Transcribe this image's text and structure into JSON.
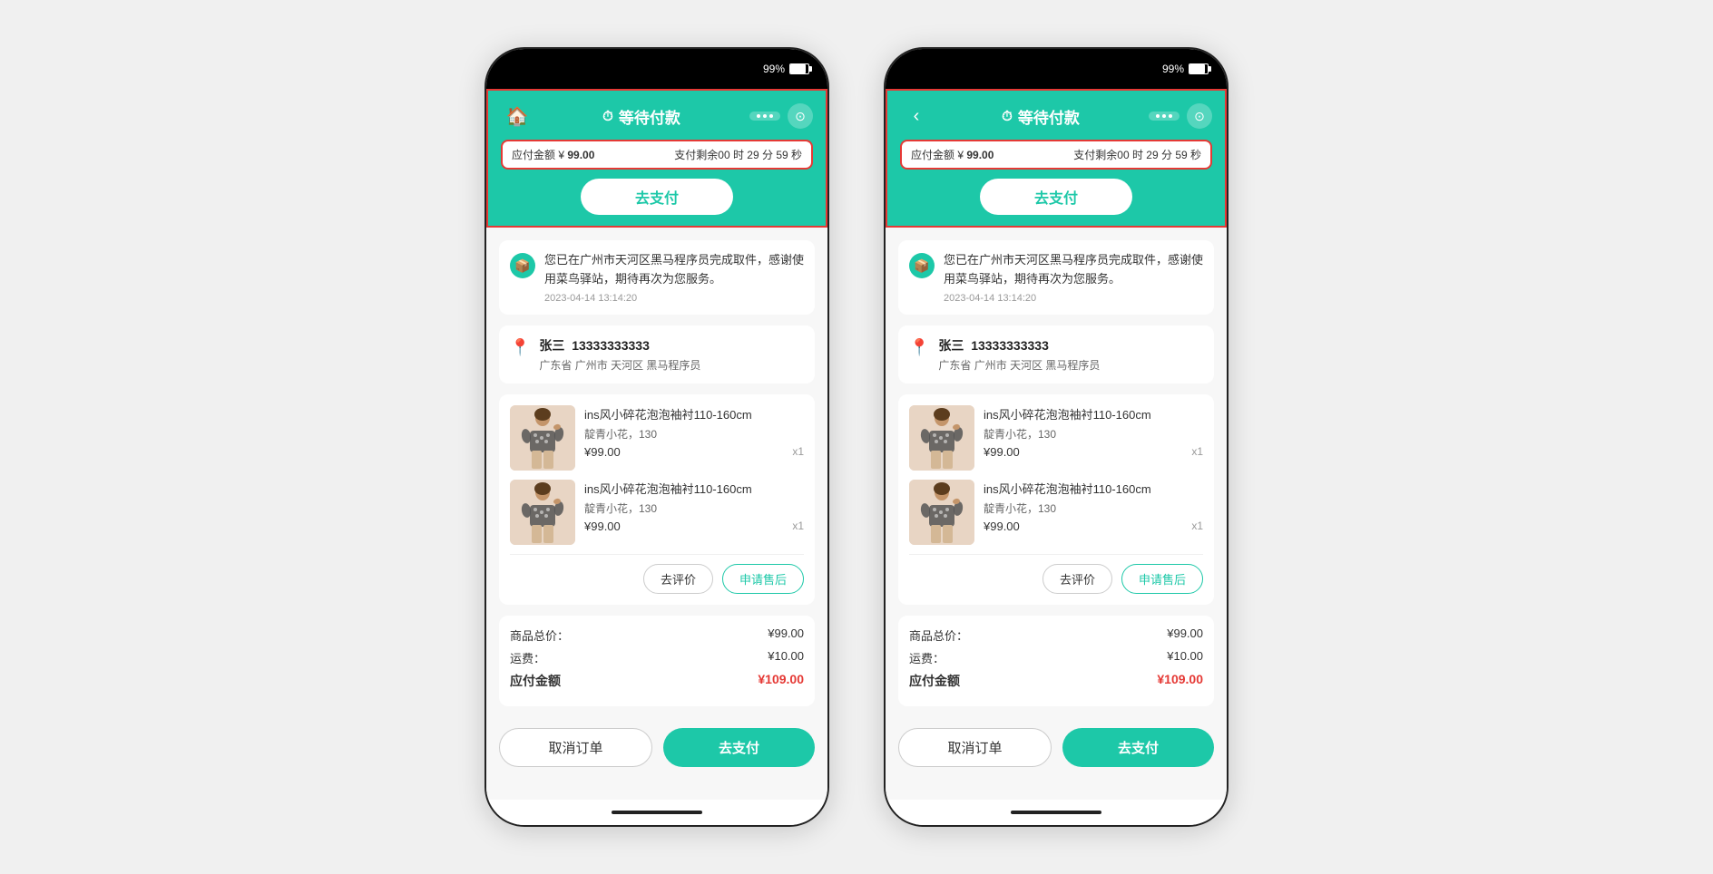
{
  "phones": [
    {
      "id": "phone-left",
      "statusBar": {
        "battery": "99%"
      },
      "header": {
        "leftIcon": "home",
        "title": "等待付款",
        "moreLabel": "···",
        "scanLabel": "⊙"
      },
      "paymentBanner": {
        "amountLabel": "应付金额",
        "amountSymbol": "¥",
        "amount": "99.00",
        "timerLabel": "支付剩余",
        "timer": "00 时 29 分 59 秒"
      },
      "payNowBtn": "去支付",
      "notification": {
        "text": "您已在广州市天河区黑马程序员完成取件，感谢使用菜鸟驿站，期待再次为您服务。",
        "date": "2023-04-14 13:14:20"
      },
      "address": {
        "name": "张三",
        "phone": "13333333333",
        "detail": "广东省 广州市 天河区 黑马程序员"
      },
      "products": [
        {
          "name": "ins风小碎花泡泡袖衬110-160cm",
          "variant": "靛青小花，130",
          "price": "¥99.00",
          "qty": "x1"
        },
        {
          "name": "ins风小碎花泡泡袖衬110-160cm",
          "variant": "靛青小花，130",
          "price": "¥99.00",
          "qty": "x1"
        }
      ],
      "actionBtns": {
        "review": "去评价",
        "afterSale": "申请售后"
      },
      "priceSummary": {
        "subtotalLabel": "商品总价：",
        "subtotalValue": "¥99.00",
        "shippingLabel": "运费：",
        "shippingValue": "¥10.00",
        "totalLabel": "应付金额",
        "totalValue": "¥109.00"
      },
      "bottomBtns": {
        "cancel": "取消订单",
        "pay": "去支付"
      }
    },
    {
      "id": "phone-right",
      "statusBar": {
        "battery": "99%"
      },
      "header": {
        "leftIcon": "back",
        "title": "等待付款",
        "moreLabel": "···",
        "scanLabel": "⊙"
      },
      "paymentBanner": {
        "amountLabel": "应付金额",
        "amountSymbol": "¥",
        "amount": "99.00",
        "timerLabel": "支付剩余",
        "timer": "00 时 29 分 59 秒"
      },
      "payNowBtn": "去支付",
      "notification": {
        "text": "您已在广州市天河区黑马程序员完成取件，感谢使用菜鸟驿站，期待再次为您服务。",
        "date": "2023-04-14 13:14:20"
      },
      "address": {
        "name": "张三",
        "phone": "13333333333",
        "detail": "广东省 广州市 天河区 黑马程序员"
      },
      "products": [
        {
          "name": "ins风小碎花泡泡袖衬110-160cm",
          "variant": "靛青小花，130",
          "price": "¥99.00",
          "qty": "x1"
        },
        {
          "name": "ins风小碎花泡泡袖衬110-160cm",
          "variant": "靛青小花，130",
          "price": "¥99.00",
          "qty": "x1"
        }
      ],
      "actionBtns": {
        "review": "去评价",
        "afterSale": "申请售后"
      },
      "priceSummary": {
        "subtotalLabel": "商品总价：",
        "subtotalValue": "¥99.00",
        "shippingLabel": "运费：",
        "shippingValue": "¥10.00",
        "totalLabel": "应付金额",
        "totalValue": "¥109.00"
      },
      "bottomBtns": {
        "cancel": "取消订单",
        "pay": "去支付"
      }
    }
  ]
}
